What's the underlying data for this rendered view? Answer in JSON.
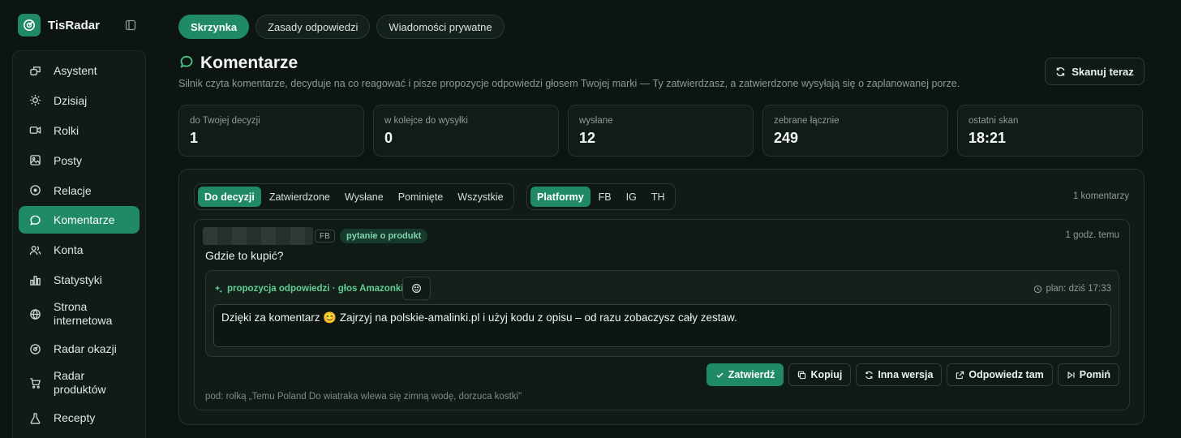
{
  "app": {
    "name": "TisRadar"
  },
  "sidebar": {
    "items": [
      {
        "label": "Asystent",
        "icon": "chat-bubbles-icon"
      },
      {
        "label": "Dzisiaj",
        "icon": "sun-icon"
      },
      {
        "label": "Rolki",
        "icon": "video-icon"
      },
      {
        "label": "Posty",
        "icon": "image-icon"
      },
      {
        "label": "Relacje",
        "icon": "circle-play-icon"
      },
      {
        "label": "Komentarze",
        "icon": "comment-icon",
        "active": true
      },
      {
        "label": "Konta",
        "icon": "users-icon"
      },
      {
        "label": "Statystyki",
        "icon": "bar-chart-icon"
      },
      {
        "label": "Strona internetowa",
        "icon": "globe-icon"
      },
      {
        "label": "Radar okazji",
        "icon": "radar-icon"
      },
      {
        "label": "Radar produktów",
        "icon": "cart-icon"
      },
      {
        "label": "Recepty",
        "icon": "flask-icon"
      }
    ]
  },
  "top_tabs": [
    {
      "label": "Skrzynka",
      "active": true
    },
    {
      "label": "Zasady odpowiedzi"
    },
    {
      "label": "Wiadomości prywatne"
    }
  ],
  "header": {
    "title": "Komentarze",
    "subtitle": "Silnik czyta komentarze, decyduje na co reagować i pisze propozycje odpowiedzi głosem Twojej marki — Ty zatwierdzasz, a zatwierdzone wysyłają się o zaplanowanej porze.",
    "scan_button": "Skanuj teraz"
  },
  "stats": [
    {
      "label": "do Twojej decyzji",
      "value": "1"
    },
    {
      "label": "w kolejce do wysyłki",
      "value": "0"
    },
    {
      "label": "wysłane",
      "value": "12"
    },
    {
      "label": "zebrane łącznie",
      "value": "249"
    },
    {
      "label": "ostatni skan",
      "value": "18:21"
    }
  ],
  "filters": {
    "status": [
      "Do decyzji",
      "Zatwierdzone",
      "Wysłane",
      "Pominięte",
      "Wszystkie"
    ],
    "platform": [
      "Platformy",
      "FB",
      "IG",
      "TH"
    ],
    "count": "1 komentarzy"
  },
  "comment": {
    "platform": "FB",
    "topic": "pytanie o produkt",
    "time_ago": "1 godz. temu",
    "text": "Gdzie to kupić?",
    "reply_label": "propozycja odpowiedzi · głos Amazonki",
    "plan": "plan: dziś 17:33",
    "reply_text": "Dzięki za komentarz 😊 Zajrzyj na polskie-amalinki.pl i użyj kodu z opisu – od razu zobaczysz cały zestaw.",
    "context": "pod: rolką „Temu Poland Do wiatraka wlewa się zimną wodę, dorzuca kostki\""
  },
  "actions": {
    "approve": "Zatwierdź",
    "copy": "Kopiuj",
    "regenerate": "Inna wersja",
    "reply_there": "Odpowiedz tam",
    "skip": "Pomiń"
  },
  "colors": {
    "accent": "#1f8a64",
    "background": "#0c1512",
    "tag_text": "#7fd6ad"
  }
}
